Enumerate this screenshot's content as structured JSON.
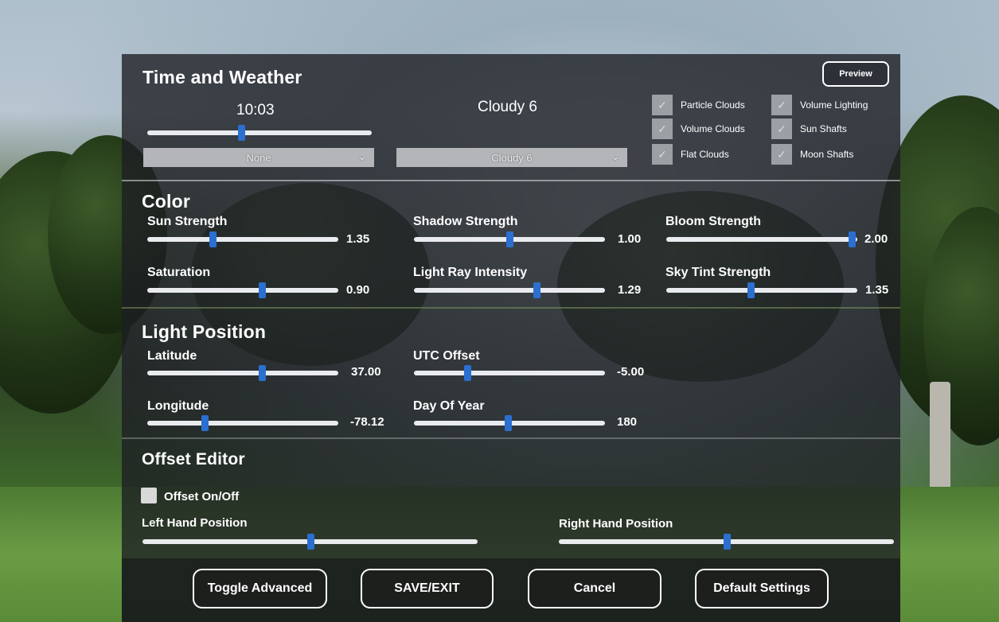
{
  "time_weather": {
    "title": "Time and Weather",
    "preview_label": "Preview",
    "time_value": "10:03",
    "time_slider": 0.42,
    "time_dropdown": "None",
    "weather_value": "Cloudy 6",
    "weather_dropdown": "Cloudy 6",
    "checkboxes": [
      {
        "label": "Particle Clouds",
        "checked": true
      },
      {
        "label": "Volume Clouds",
        "checked": true
      },
      {
        "label": "Flat Clouds",
        "checked": true
      },
      {
        "label": "Volume Lighting",
        "checked": true
      },
      {
        "label": "Sun Shafts",
        "checked": true
      },
      {
        "label": "Moon Shafts",
        "checked": true
      }
    ]
  },
  "color": {
    "title": "Color",
    "sliders": [
      {
        "label": "Sun Strength",
        "value": "1.35",
        "level": 0.34
      },
      {
        "label": "Shadow Strength",
        "value": "1.00",
        "level": 0.5
      },
      {
        "label": "Bloom Strength",
        "value": "2.00",
        "level": 1.0
      },
      {
        "label": "Saturation",
        "value": "0.90",
        "level": 0.6
      },
      {
        "label": "Light Ray Intensity",
        "value": "1.29",
        "level": 0.64
      },
      {
        "label": "Sky Tint Strength",
        "value": "1.35",
        "level": 0.44
      }
    ]
  },
  "light_position": {
    "title": "Light Position",
    "sliders": [
      {
        "label": "Latitude",
        "value": "37.00",
        "level": 0.6
      },
      {
        "label": "UTC Offset",
        "value": "-5.00",
        "level": 0.28
      },
      {
        "label": "Longitude",
        "value": "-78.12",
        "level": 0.3
      },
      {
        "label": "Day Of Year",
        "value": "180",
        "level": 0.49
      }
    ]
  },
  "offset_editor": {
    "title": "Offset Editor",
    "toggle_label": "Offset On/Off",
    "left_label": "Left Hand Position",
    "left_level": 0.5,
    "right_label": "Right Hand Position",
    "right_level": 0.5
  },
  "buttons": {
    "toggle_advanced": "Toggle Advanced",
    "save_exit": "SAVE/EXIT",
    "cancel": "Cancel",
    "default_settings": "Default Settings"
  },
  "colors": {
    "panel": "#1c1e22",
    "slider_thumb": "#2b6fd0",
    "slider_track": "#e9ebee"
  }
}
